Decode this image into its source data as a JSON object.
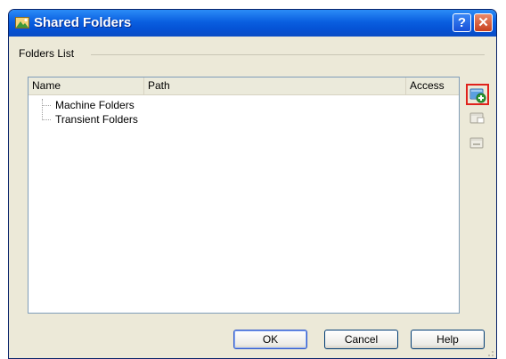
{
  "window": {
    "title": "Shared Folders",
    "help_button": "?",
    "close_button": "✕"
  },
  "group": {
    "label": "Folders List"
  },
  "list": {
    "columns": [
      "Name",
      "Path",
      "Access"
    ],
    "items": [
      {
        "label": "Machine Folders"
      },
      {
        "label": "Transient Folders"
      }
    ]
  },
  "side_buttons": {
    "add": "add-shared-folder-icon",
    "edit": "edit-shared-folder-icon",
    "remove": "remove-shared-folder-icon"
  },
  "buttons": {
    "ok": "OK",
    "cancel": "Cancel",
    "help": "Help"
  },
  "colors": {
    "title_bar": "#0a5fe0",
    "highlight_border": "#e0221c"
  }
}
